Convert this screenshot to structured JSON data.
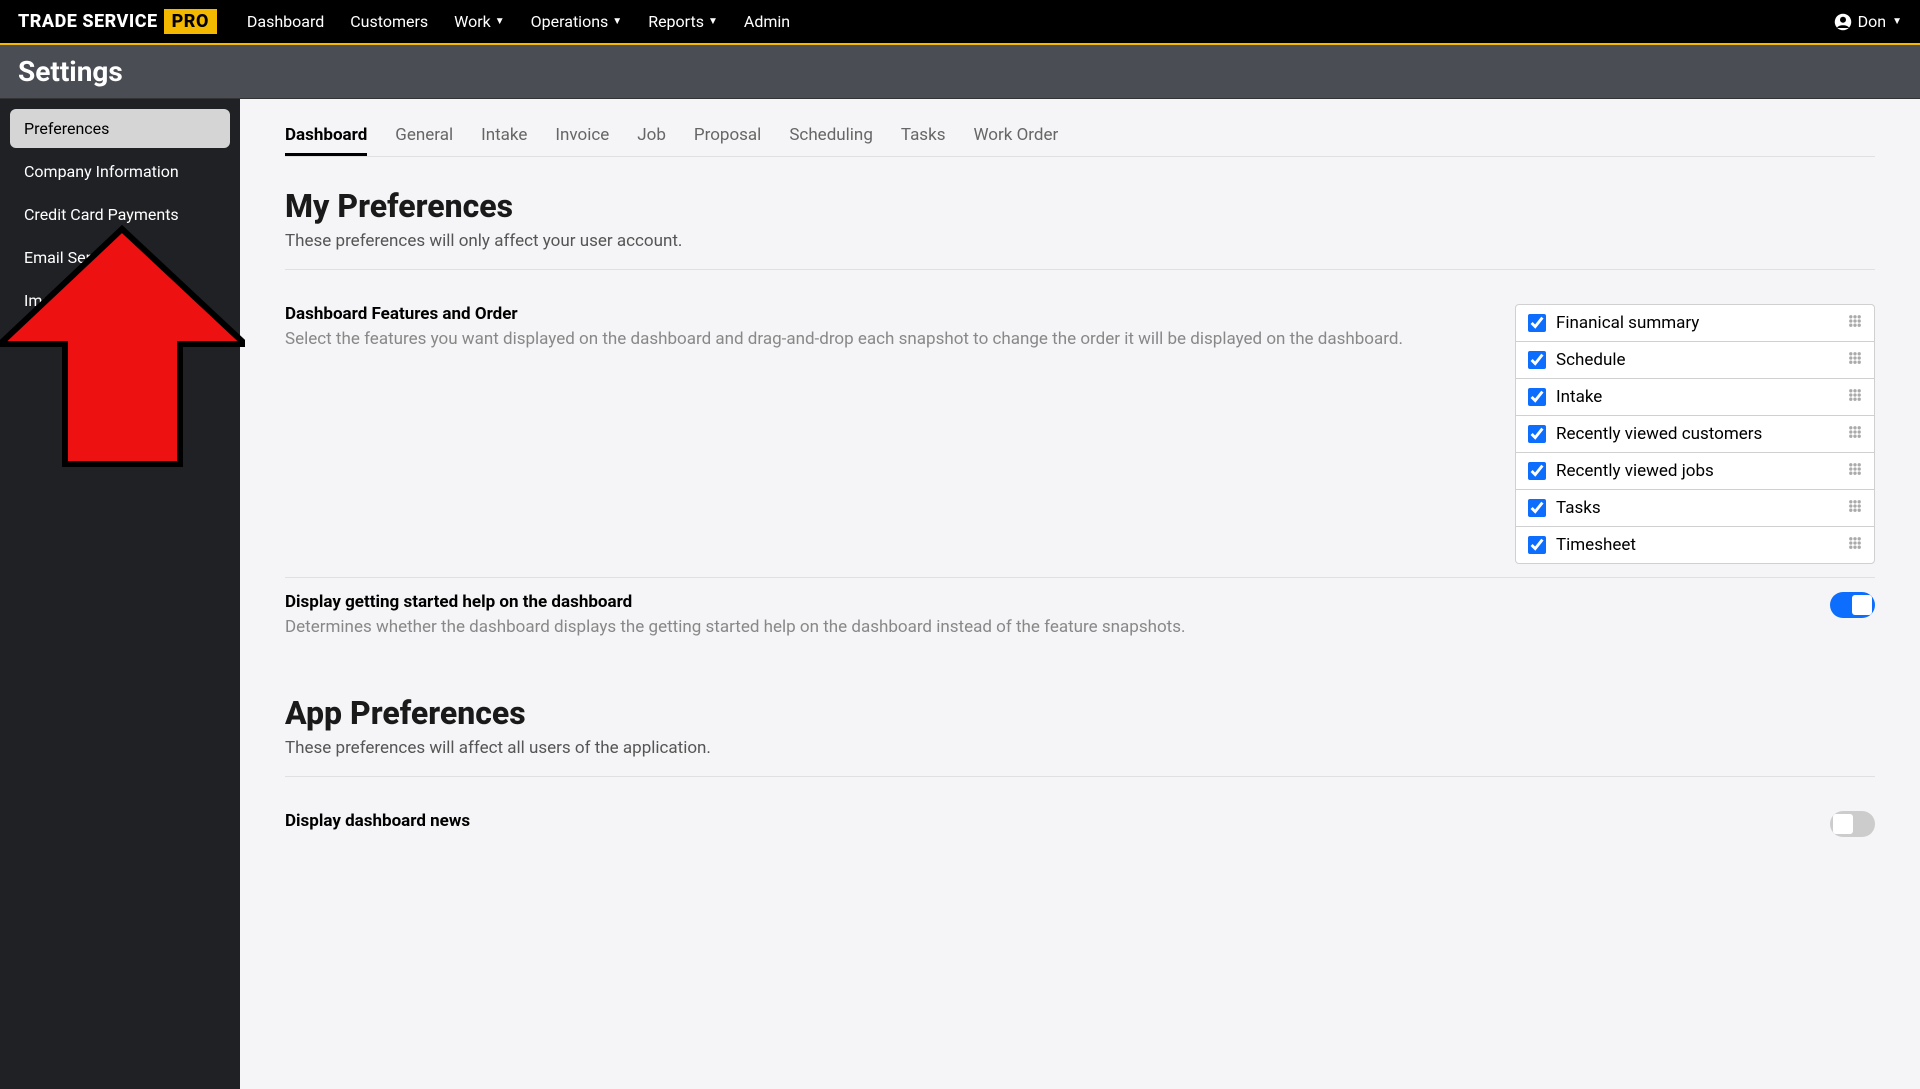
{
  "logo": {
    "text1": "TRADE SERVICE",
    "text2": "PRO"
  },
  "nav": {
    "dashboard": "Dashboard",
    "customers": "Customers",
    "work": "Work",
    "operations": "Operations",
    "reports": "Reports",
    "admin": "Admin"
  },
  "user": {
    "name": "Don"
  },
  "page_title": "Settings",
  "sidebar": {
    "items": [
      {
        "label": "Preferences",
        "active": true
      },
      {
        "label": "Company Information"
      },
      {
        "label": "Credit Card Payments"
      },
      {
        "label": "Email Server"
      },
      {
        "label": "Images"
      }
    ]
  },
  "tabs": [
    {
      "label": "Dashboard",
      "active": true
    },
    {
      "label": "General"
    },
    {
      "label": "Intake"
    },
    {
      "label": "Invoice"
    },
    {
      "label": "Job"
    },
    {
      "label": "Proposal"
    },
    {
      "label": "Scheduling"
    },
    {
      "label": "Tasks"
    },
    {
      "label": "Work Order"
    }
  ],
  "my_prefs": {
    "heading": "My Preferences",
    "sub": "These preferences will only affect your user account."
  },
  "features": {
    "title": "Dashboard Features and Order",
    "desc": "Select the features you want displayed on the dashboard and drag-and-drop each snapshot to change the order it will be displayed on the dashboard.",
    "items": [
      {
        "label": "Finanical summary",
        "checked": true
      },
      {
        "label": "Schedule",
        "checked": true
      },
      {
        "label": "Intake",
        "checked": true
      },
      {
        "label": "Recently viewed customers",
        "checked": true
      },
      {
        "label": "Recently viewed jobs",
        "checked": true
      },
      {
        "label": "Tasks",
        "checked": true
      },
      {
        "label": "Timesheet",
        "checked": true
      }
    ]
  },
  "getting_started": {
    "title": "Display getting started help on the dashboard",
    "desc": "Determines whether the dashboard displays the getting started help on the dashboard instead of the feature snapshots.",
    "on": true
  },
  "app_prefs": {
    "heading": "App Preferences",
    "sub": "These preferences will affect all users of the application."
  },
  "dashboard_news": {
    "title": "Display dashboard news",
    "on": false
  }
}
